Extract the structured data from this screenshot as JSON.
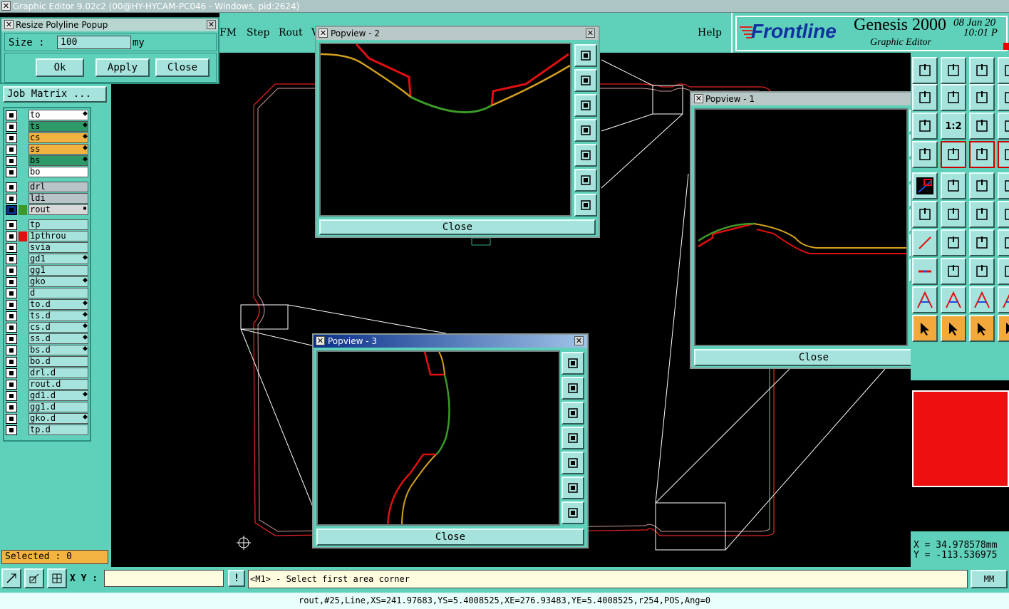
{
  "app": {
    "title": "Graphic Editor 9.02c2 (00@HY-HYCAM-PC046 - Windows, pid:2624)"
  },
  "menu": {
    "items": [
      "FM",
      "Step",
      "Rout",
      "V"
    ],
    "help": "Help"
  },
  "brand": {
    "logo": "Frontline",
    "product": "Genesis 2000",
    "subtitle": "Graphic Editor",
    "date": "08 Jan 20",
    "time": "10:01 P"
  },
  "resize_popup": {
    "title": "Resize Polyline Popup",
    "size_label": "Size :",
    "size_value": "100",
    "unit": "my",
    "ok": "Ok",
    "apply": "Apply",
    "close": "Close"
  },
  "job_matrix": {
    "label": "Job Matrix ..."
  },
  "layers": {
    "group1": [
      {
        "name": "to",
        "color": "#ffffff",
        "mark": "⬥"
      },
      {
        "name": "ts",
        "color": "#2e9a6a",
        "mark": "⬥"
      },
      {
        "name": "cs",
        "color": "#f2b340",
        "mark": "⬥"
      },
      {
        "name": "ss",
        "color": "#f2b340",
        "mark": "⬥"
      },
      {
        "name": "bs",
        "color": "#2e9a6a",
        "mark": "⬥"
      },
      {
        "name": "bo",
        "color": "#ffffff",
        "mark": ""
      }
    ],
    "group2": [
      {
        "name": "drl",
        "color": "#b8c4c8",
        "mark": ""
      },
      {
        "name": "ldi",
        "color": "#b8c4c8",
        "mark": ""
      },
      {
        "name": "rout",
        "color": "#d8d8d8",
        "mark": "▪"
      }
    ],
    "group3": [
      {
        "name": "tp",
        "color": "#a6e3dc",
        "mark": ""
      },
      {
        "name": "1pthrou",
        "color": "#a6e3dc",
        "mark": ""
      },
      {
        "name": "svia",
        "color": "#a6e3dc",
        "mark": ""
      },
      {
        "name": "gd1",
        "color": "#a6e3dc",
        "mark": "⬥"
      },
      {
        "name": "gg1",
        "color": "#a6e3dc",
        "mark": ""
      },
      {
        "name": "gko",
        "color": "#a6e3dc",
        "mark": "⬥"
      },
      {
        "name": "d",
        "color": "#a6e3dc",
        "mark": ""
      },
      {
        "name": "to.d",
        "color": "#a6e3dc",
        "mark": "⬥"
      },
      {
        "name": "ts.d",
        "color": "#a6e3dc",
        "mark": "⬥"
      },
      {
        "name": "cs.d",
        "color": "#a6e3dc",
        "mark": "⬥"
      },
      {
        "name": "ss.d",
        "color": "#a6e3dc",
        "mark": "⬥"
      },
      {
        "name": "bs.d",
        "color": "#a6e3dc",
        "mark": "⬥"
      },
      {
        "name": "bo.d",
        "color": "#a6e3dc",
        "mark": ""
      },
      {
        "name": "drl.d",
        "color": "#a6e3dc",
        "mark": ""
      },
      {
        "name": "rout.d",
        "color": "#a6e3dc",
        "mark": ""
      },
      {
        "name": "gd1.d",
        "color": "#a6e3dc",
        "mark": "⬥"
      },
      {
        "name": "gg1.d",
        "color": "#a6e3dc",
        "mark": ""
      },
      {
        "name": "gko.d",
        "color": "#a6e3dc",
        "mark": "⬥"
      },
      {
        "name": "tp.d",
        "color": "#a6e3dc",
        "mark": ""
      }
    ]
  },
  "selected": "Selected : 0",
  "popviews": {
    "p1": {
      "title": "Popview - 1",
      "close": "Close"
    },
    "p2": {
      "title": "Popview - 2",
      "close": "Close"
    },
    "p3": {
      "title": "Popview - 3",
      "close": "Close"
    }
  },
  "toolbar_right": {
    "ratio_label": "1:2"
  },
  "coords": {
    "x": "X = 34.978578mm",
    "y": "Y = -113.536975"
  },
  "bottom": {
    "xy_label": "X Y :",
    "xy_value": "",
    "exclaim": "!",
    "prompt": "<M1> - Select first area corner",
    "units": "MM",
    "status": "rout,#25,Line,XS=241.97683,YS=5.4008525,XE=276.93483,YE=5.4008525,r254,POS,Ang=0"
  },
  "colors": {
    "panel": "#5fd0b9",
    "light": "#a6e3dc",
    "outline": "#e02020",
    "selected_bg": "#f2b340"
  }
}
